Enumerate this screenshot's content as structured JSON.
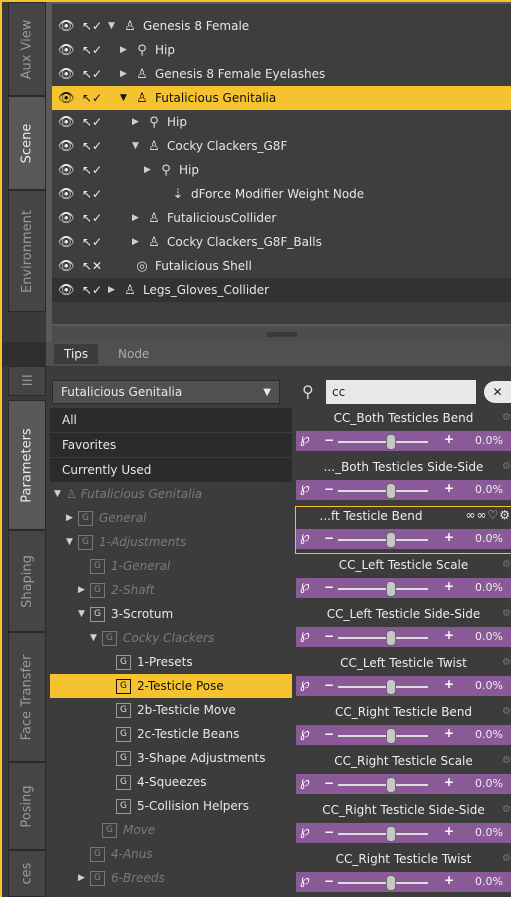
{
  "side_tabs_top": [
    "Aux View",
    "Scene",
    "Environment"
  ],
  "side_tabs_bottom": [
    "Parameters",
    "Shaping",
    "Face Transfer",
    "Posing",
    "ces"
  ],
  "scene_tree": [
    {
      "label": "Genesis 8 Female",
      "icon": "figure-icon",
      "twist": "▼"
    },
    {
      "label": "Hip",
      "icon": "bone-icon",
      "twist": "▶"
    },
    {
      "label": "Genesis 8 Female Eyelashes",
      "icon": "figure-icon",
      "twist": "▶"
    },
    {
      "label": "Futalicious Genitalia",
      "icon": "figure-icon",
      "twist": "▼"
    },
    {
      "label": "Hip",
      "icon": "bone-icon",
      "twist": "▶"
    },
    {
      "label": "Cocky Clackers_G8F",
      "icon": "figure-icon",
      "twist": "▼"
    },
    {
      "label": "Hip",
      "icon": "bone-icon",
      "twist": "▶"
    },
    {
      "label": "dForce Modifier Weight Node",
      "icon": "weight-node-icon",
      "twist": ""
    },
    {
      "label": "FutaliciousCollider",
      "icon": "figure-icon",
      "twist": "▶"
    },
    {
      "label": "Cocky Clackers_G8F_Balls",
      "icon": "figure-icon",
      "twist": "▶"
    },
    {
      "label": "Futalicious Shell",
      "icon": "shell-icon",
      "twist": ""
    },
    {
      "label": "Legs_Gloves_Collider",
      "icon": "figure-icon",
      "twist": "▶"
    }
  ],
  "panel_tabs": [
    "Tips",
    "Node"
  ],
  "node_dropdown": "Futalicious Genitalia",
  "quick_groups": [
    "All",
    "Favorites",
    "Currently Used"
  ],
  "property_groups": [
    {
      "label": "Futalicious Genitalia",
      "twist": "▼",
      "icon": "figure-icon",
      "style": "dim"
    },
    {
      "label": "General",
      "twist": "▶",
      "style": "dim"
    },
    {
      "label": "1-Adjustments",
      "twist": "▼",
      "style": "dim"
    },
    {
      "label": "1-General",
      "twist": "",
      "style": "dim"
    },
    {
      "label": "2-Shaft",
      "twist": "▶",
      "style": "dim"
    },
    {
      "label": "3-Scrotum",
      "twist": "▼",
      "style": "normal"
    },
    {
      "label": "Cocky Clackers",
      "twist": "▼",
      "style": "dim"
    },
    {
      "label": "1-Presets",
      "twist": "",
      "style": "normal"
    },
    {
      "label": "2-Testicle Pose",
      "twist": "",
      "style": "selected"
    },
    {
      "label": "2b-Testicle Move",
      "twist": "",
      "style": "normal"
    },
    {
      "label": "2c-Testicle Beans",
      "twist": "",
      "style": "normal"
    },
    {
      "label": "3-Shape Adjustments",
      "twist": "",
      "style": "normal"
    },
    {
      "label": "4-Squeezes",
      "twist": "",
      "style": "normal"
    },
    {
      "label": "5-Collision Helpers",
      "twist": "",
      "style": "normal"
    },
    {
      "label": "Move",
      "twist": "",
      "style": "dim"
    },
    {
      "label": "4-Anus",
      "twist": "",
      "style": "dim"
    },
    {
      "label": "6-Breeds",
      "twist": "▶",
      "style": "dim"
    }
  ],
  "search": {
    "value": "cc",
    "clear_label": "✕"
  },
  "sliders": [
    {
      "title": "CC_Both Testicles Bend",
      "value": "0.0%"
    },
    {
      "title": "..._Both Testicles Side-Side",
      "value": "0.0%"
    },
    {
      "title": "...ft Testicle Bend",
      "value": "0.0%"
    },
    {
      "title": "CC_Left Testicle Scale",
      "value": "0.0%"
    },
    {
      "title": "CC_Left Testicle Side-Side",
      "value": "0.0%"
    },
    {
      "title": "CC_Left Testicle Twist",
      "value": "0.0%"
    },
    {
      "title": "CC_Right Testicle Bend",
      "value": "0.0%"
    },
    {
      "title": "CC_Right Testicle Scale",
      "value": "0.0%"
    },
    {
      "title": "CC_Right Testicle Side-Side",
      "value": "0.0%"
    },
    {
      "title": "CC_Right Testicle Twist",
      "value": "0.0%"
    }
  ],
  "colors": {
    "accent": "#f5c230",
    "slider_bar": "#8a5a98"
  }
}
